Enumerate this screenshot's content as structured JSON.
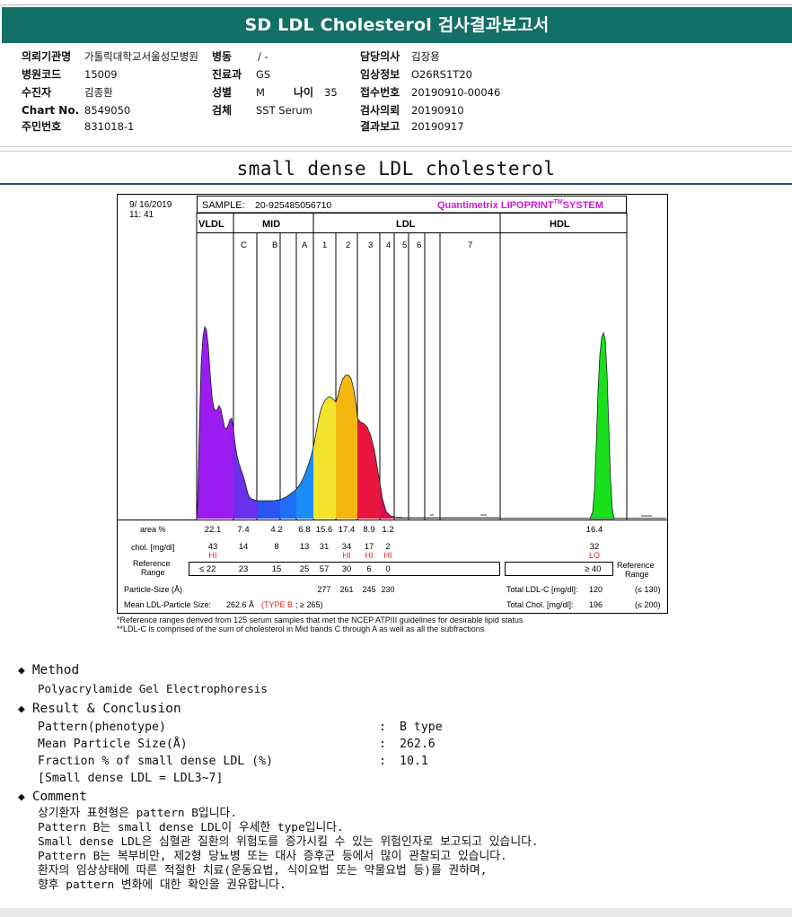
{
  "report": {
    "title": "SD LDL Cholesterol 검사결과보고서",
    "subtitle": "small dense LDL cholesterol"
  },
  "patient": {
    "requesting_institution_label": "의뢰기관명",
    "requesting_institution": "가톨릭대학교서울성모병원",
    "ward_label": "병동",
    "ward": "/ -",
    "attending_label": "담당의사",
    "attending": "김장용",
    "hospital_code_label": "병원코드",
    "hospital_code": "15009",
    "department_label": "진료과",
    "department": "GS",
    "clinical_info_label": "임상정보",
    "clinical_info": "O26RS1T20",
    "examinee_label": "수진자",
    "examinee": "김종환",
    "sex_label": "성별",
    "sex": "M",
    "age_label": "나이",
    "age": "35",
    "receipt_no_label": "접수번호",
    "receipt_no": "20190910-00046",
    "chart_no_label": "Chart No.",
    "chart_no": "8549050",
    "specimen_label": "검체",
    "specimen": "SST Serum",
    "request_date_label": "검사의뢰",
    "request_date": "20190910",
    "id_no_label": "주민번호",
    "id_no": "831018-1",
    "report_date_label": "결과보고",
    "report_date": "20190917"
  },
  "lipoprint": {
    "date": "9/ 16/2019",
    "time": "11: 41",
    "sample_label": "SAMPLE:",
    "sample": "20-925485056710",
    "brand": "Quantimetrix LIPOPRINT",
    "brand_tm": "TM",
    "brand_suffix": "SYSTEM",
    "groups": [
      "VLDL",
      "MID",
      "LDL",
      "HDL"
    ],
    "bands": [
      "C",
      "B",
      "A",
      "1",
      "2",
      "3",
      "4",
      "5",
      "6",
      "7"
    ],
    "area_label": "area %",
    "chol_label": "chol. [mg/dl]",
    "ref_label": "Reference Range",
    "ref_label_right": "Reference Range",
    "particle_label": "Particle-Size (Å)",
    "mean_size_text": "Mean LDL-Particle Size:",
    "mean_size_value": "262.6 Å",
    "mean_size_type": "(TYPE B",
    "mean_size_ref": "; ≥ 265)",
    "total_ldl_label": "Total LDL-C [mg/dl]:",
    "total_ldl": "120",
    "total_ldl_ref": "(≤ 130)",
    "total_chol_label": "Total Chol. [mg/dl]:",
    "total_chol": "196",
    "total_chol_ref": "(≤ 200)",
    "area": [
      "22.1",
      "7.4",
      "4.2",
      "6.8",
      "15.6",
      "17.4",
      "8.9",
      "1.2",
      "16.4"
    ],
    "chol": [
      "43",
      "14",
      "8",
      "13",
      "31",
      "34",
      "17",
      "2",
      "32"
    ],
    "flags": [
      "HI",
      "",
      "",
      "",
      "",
      "HI",
      "HI",
      "HI",
      "LO"
    ],
    "ref_range": [
      "≤ 22",
      "23",
      "15",
      "25",
      "57",
      "30",
      "6",
      "0",
      "≥ 40"
    ],
    "particle_sizes": [
      "277",
      "261",
      "245",
      "230"
    ],
    "note1": "*Reference ranges derived from 125 serum samples that met the NCEP ATPIII guidelines for desirable lipid status",
    "note2": "**LDL-C is comprised of the sum of cholesterol in Mid bands C through A as well as all the subfractions",
    "colors": {
      "vldl": "#9b1cf0",
      "midc": "#6a2fe8",
      "midb": "#2a55f2",
      "mida": "#1a8cf3",
      "l1": "#f2e42c",
      "l2": "#f3b70f",
      "l3": "#e8163f",
      "hdl": "#19e01c",
      "brand": "#d11ad6",
      "flag": "#e52222",
      "header": "#127066"
    }
  },
  "method": {
    "heading": "Method",
    "text": "Polyacrylamide Gel Electrophoresis"
  },
  "result": {
    "heading": "Result & Conclusion",
    "rows": [
      {
        "label": "Pattern(phenotype)",
        "value": "B type"
      },
      {
        "label": "Mean Particle Size(Å)",
        "value": "262.6"
      },
      {
        "label": "Fraction % of small dense LDL (%)",
        "value": "10.1"
      },
      {
        "label": "[Small dense LDL = LDL3~7]",
        "value": ""
      }
    ]
  },
  "comment": {
    "heading": "Comment",
    "lines": [
      "상기환자 표현형은 pattern B입니다.",
      "Pattern B는 small dense LDL이 우세한 type입니다.",
      "Small dense LDL은 심혈관 질환의 위험도를 증가시킬 수 있는 위험인자로 보고되고 있습니다.",
      "Pattern B는 복부비만, 제2형 당뇨병 또는 대사 증후군 등에서 많이 관찰되고 있습니다.",
      "환자의 임상상태에 따른 적절한 치료(운동요법, 식이요법 또는 약물요법 등)를 권하며,",
      "향후 pattern 변화에 대한 확인을 권유합니다."
    ]
  }
}
